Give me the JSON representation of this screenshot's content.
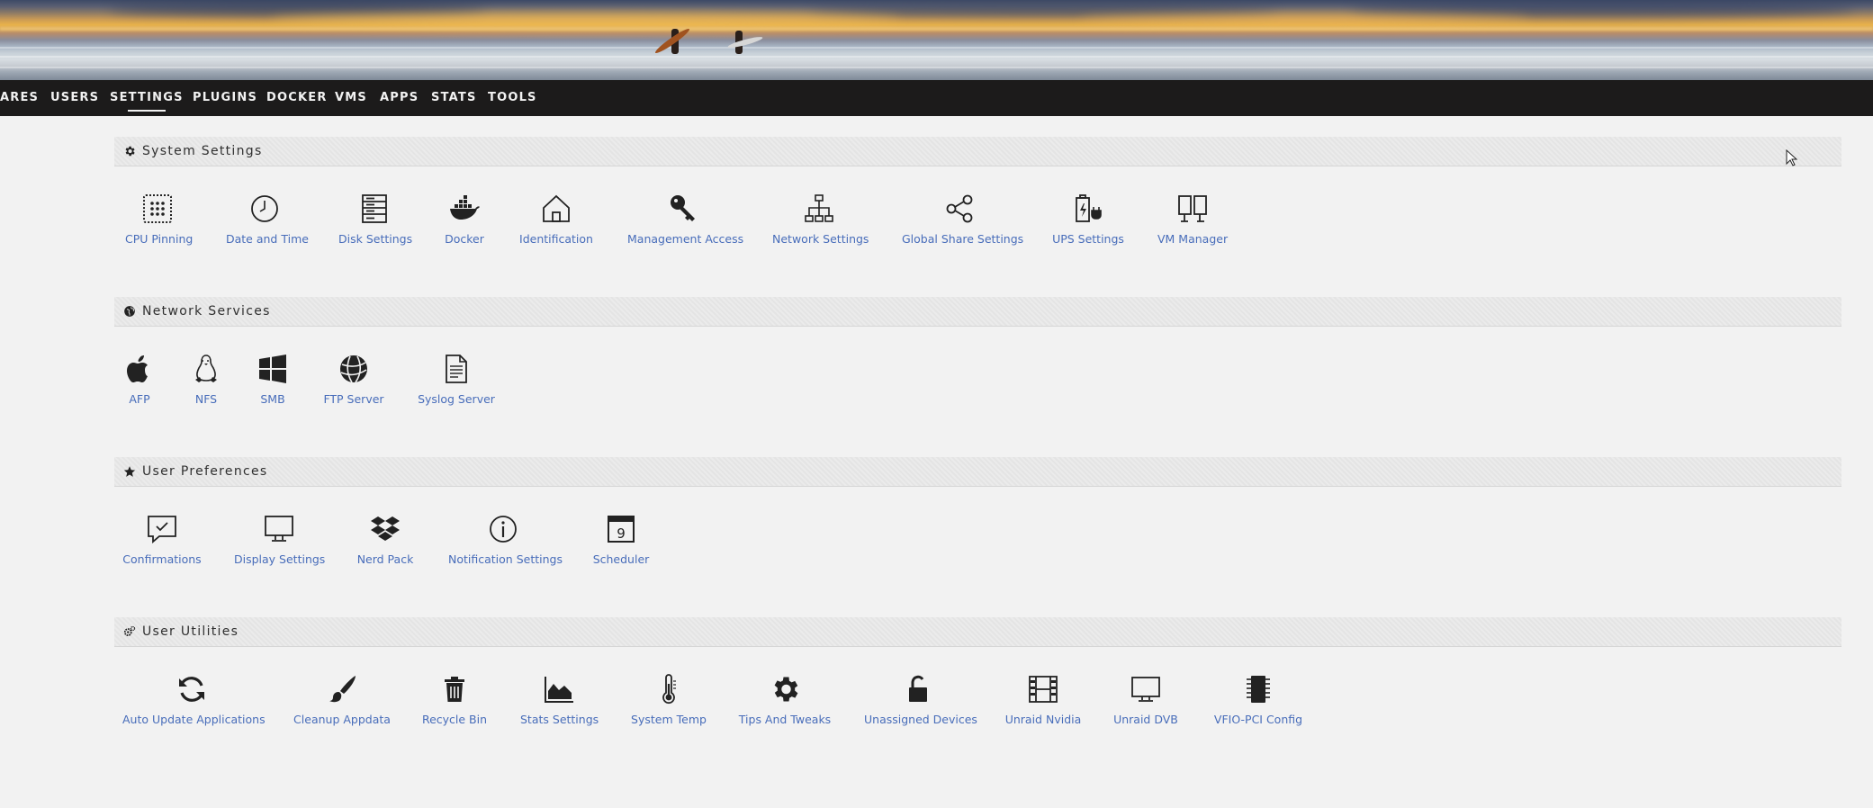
{
  "nav": {
    "items": [
      "ARES",
      "USERS",
      "SETTINGS",
      "PLUGINS",
      "DOCKER",
      "VMS",
      "APPS",
      "STATS",
      "TOOLS"
    ],
    "active": "SETTINGS"
  },
  "sections": {
    "system": {
      "title": "System Settings",
      "icon": "gear-icon",
      "items": [
        "CPU Pinning",
        "Date and Time",
        "Disk Settings",
        "Docker",
        "Identification",
        "Management Access",
        "Network Settings",
        "Global Share Settings",
        "UPS Settings",
        "VM Manager"
      ]
    },
    "network": {
      "title": "Network Services",
      "icon": "globe-icon",
      "items": [
        "AFP",
        "NFS",
        "SMB",
        "FTP Server",
        "Syslog Server"
      ]
    },
    "prefs": {
      "title": "User Preferences",
      "icon": "star-icon",
      "items": [
        "Confirmations",
        "Display Settings",
        "Nerd Pack",
        "Notification Settings",
        "Scheduler"
      ]
    },
    "utilities": {
      "title": "User Utilities",
      "icon": "cogs-icon",
      "items": [
        "Auto Update Applications",
        "Cleanup Appdata",
        "Recycle Bin",
        "Stats Settings",
        "System Temp",
        "Tips And Tweaks",
        "Unassigned Devices",
        "Unraid Nvidia",
        "Unraid DVB",
        "VFIO-PCI Config"
      ]
    }
  },
  "scheduler_day": "9",
  "colors": {
    "link": "#486dba",
    "navbar": "#1c1b1b",
    "background": "#f2f2f2"
  }
}
